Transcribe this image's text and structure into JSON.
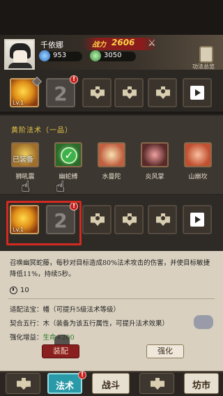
{
  "header": {
    "player_name": "千依娜",
    "power_label": "战力",
    "power_value": "2606",
    "resource_1": "953",
    "resource_2": "3050",
    "armory_label": "功法总览"
  },
  "top_row": {
    "skill_level": "Lv.1",
    "slot_2_number": "2"
  },
  "category": {
    "title": "黄阶法术（一品）",
    "equipped_tag": "已装备",
    "spells": [
      {
        "name": "狮吼震"
      },
      {
        "name": "幽蛇缚"
      },
      {
        "name": "水曼陀"
      },
      {
        "name": "炎风掌"
      },
      {
        "name": "山崩坎"
      }
    ]
  },
  "bottom_row": {
    "skill_level": "Lv.1",
    "slot_2_number": "2"
  },
  "detail": {
    "description": "召唤幽冥蛇藤，每秒对目标造成80%法术攻击的伤害，并使目标敏捷降低11%，持续5秒。",
    "cooldown": "10",
    "attributes": [
      {
        "label": "适配法宝：",
        "value": "幡（可提升5级法术等级）"
      },
      {
        "label": "契合五行：",
        "value": "木（装备为该五行属性，可提升法术效果）"
      },
      {
        "label": "强化增益：",
        "value": "生命+200"
      }
    ],
    "equip_button": "装配",
    "enhance_button": "强化"
  },
  "nav": {
    "spell": "法术",
    "battle": "战斗",
    "market": "坊市"
  },
  "colors": {
    "accent_red": "#d32a22",
    "gold_text": "#e8c84a",
    "nav_active": "#2b9aa8"
  }
}
